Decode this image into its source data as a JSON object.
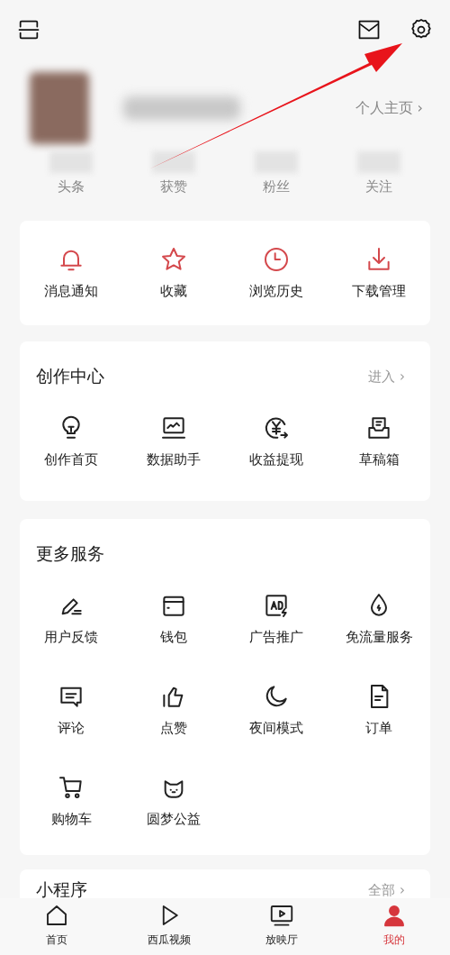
{
  "profile": {
    "home_link": "个人主页 ›",
    "stats": [
      {
        "label": "头条"
      },
      {
        "label": "获赞"
      },
      {
        "label": "粉丝"
      },
      {
        "label": "关注"
      }
    ]
  },
  "quick_actions": [
    {
      "label": "消息通知"
    },
    {
      "label": "收藏"
    },
    {
      "label": "浏览历史"
    },
    {
      "label": "下载管理"
    }
  ],
  "creator_center": {
    "title": "创作中心",
    "link": "进入 ›",
    "items": [
      {
        "label": "创作首页"
      },
      {
        "label": "数据助手"
      },
      {
        "label": "收益提现"
      },
      {
        "label": "草稿箱"
      }
    ]
  },
  "more_services": {
    "title": "更多服务",
    "items": [
      {
        "label": "用户反馈"
      },
      {
        "label": "钱包"
      },
      {
        "label": "广告推广"
      },
      {
        "label": "免流量服务"
      },
      {
        "label": "评论"
      },
      {
        "label": "点赞"
      },
      {
        "label": "夜间模式"
      },
      {
        "label": "订单"
      },
      {
        "label": "购物车"
      },
      {
        "label": "圆梦公益"
      }
    ]
  },
  "mini_programs": {
    "title": "小程序",
    "link": "全部 ›"
  },
  "bottom_nav": [
    {
      "label": "首页",
      "selected": false
    },
    {
      "label": "西瓜视频",
      "selected": false
    },
    {
      "label": "放映厅",
      "selected": false
    },
    {
      "label": "我的",
      "selected": true
    }
  ]
}
